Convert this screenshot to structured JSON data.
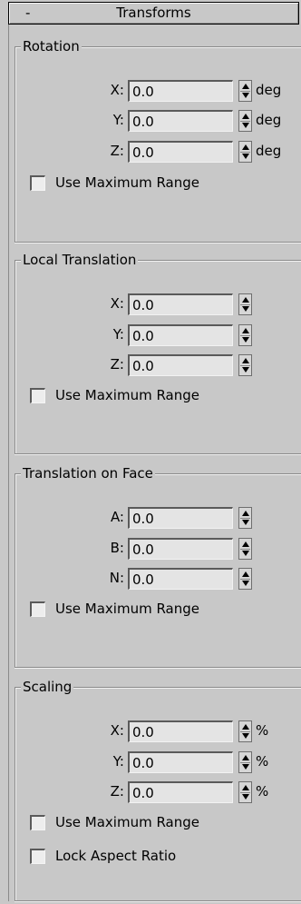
{
  "rollout": {
    "toggle": "-",
    "title": "Transforms"
  },
  "rotation": {
    "title": "Rotation",
    "fields": [
      {
        "label": "X:",
        "value": "0.0",
        "unit": "deg"
      },
      {
        "label": "Y:",
        "value": "0.0",
        "unit": "deg"
      },
      {
        "label": "Z:",
        "value": "0.0",
        "unit": "deg"
      }
    ],
    "use_max_range": "Use Maximum Range"
  },
  "local_translation": {
    "title": "Local Translation",
    "fields": [
      {
        "label": "X:",
        "value": "0.0"
      },
      {
        "label": "Y:",
        "value": "0.0"
      },
      {
        "label": "Z:",
        "value": "0.0"
      }
    ],
    "use_max_range": "Use Maximum Range"
  },
  "translation_on_face": {
    "title": "Translation on Face",
    "fields": [
      {
        "label": "A:",
        "value": "0.0"
      },
      {
        "label": "B:",
        "value": "0.0"
      },
      {
        "label": "N:",
        "value": "0.0"
      }
    ],
    "use_max_range": "Use Maximum Range"
  },
  "scaling": {
    "title": "Scaling",
    "fields": [
      {
        "label": "X:",
        "value": "0.0",
        "unit": "%"
      },
      {
        "label": "Y:",
        "value": "0.0",
        "unit": "%"
      },
      {
        "label": "Z:",
        "value": "0.0",
        "unit": "%"
      }
    ],
    "use_max_range": "Use Maximum Range",
    "lock_aspect": "Lock Aspect Ratio"
  }
}
